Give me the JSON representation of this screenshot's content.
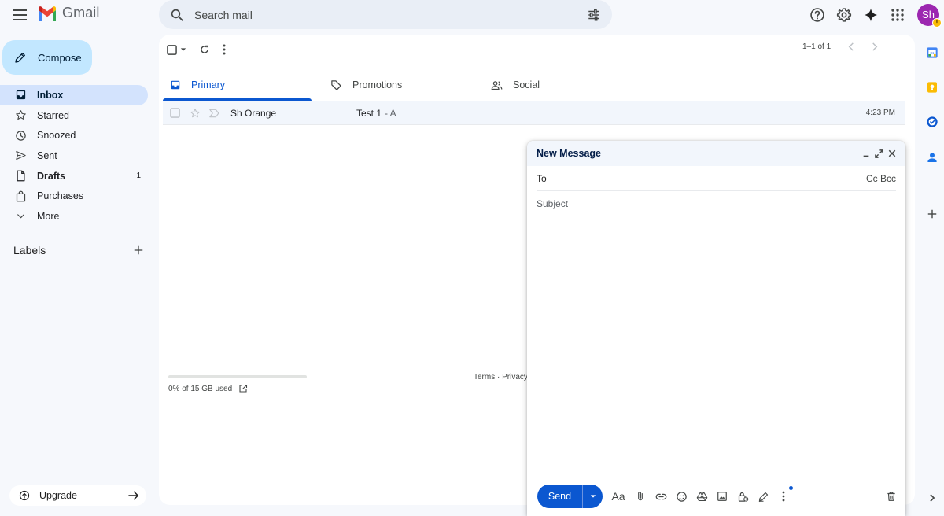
{
  "app": {
    "name": "Gmail"
  },
  "search": {
    "placeholder": "Search mail"
  },
  "user": {
    "avatar_initials": "Sh",
    "badge": "!"
  },
  "sidebar": {
    "compose_label": "Compose",
    "items": [
      {
        "label": "Inbox",
        "icon": "inbox-icon",
        "active": true
      },
      {
        "label": "Starred",
        "icon": "star-icon"
      },
      {
        "label": "Snoozed",
        "icon": "clock-icon"
      },
      {
        "label": "Sent",
        "icon": "send-icon"
      },
      {
        "label": "Drafts",
        "icon": "draft-icon",
        "count": "1",
        "bold": true
      },
      {
        "label": "Purchases",
        "icon": "shopping-bag-icon"
      },
      {
        "label": "More",
        "icon": "chevron-down-icon"
      }
    ],
    "labels_heading": "Labels",
    "upgrade_label": "Upgrade"
  },
  "list": {
    "pagination": "1–1 of 1",
    "tabs": [
      {
        "label": "Primary",
        "icon": "inbox-icon",
        "active": true
      },
      {
        "label": "Promotions",
        "icon": "tag-icon"
      },
      {
        "label": "Social",
        "icon": "people-icon"
      }
    ],
    "emails": [
      {
        "sender": "Sh Orange",
        "subject": "Test 1",
        "snippet": "- A",
        "time": "4:23 PM"
      }
    ]
  },
  "storage": {
    "text": "0% of 15 GB used",
    "fraction": 0
  },
  "footer": {
    "links": "Terms · Privacy"
  },
  "compose_window": {
    "title": "New Message",
    "to_label": "To",
    "cc_bcc": "Cc Bcc",
    "subject_placeholder": "Subject",
    "send_label": "Send",
    "format_label": "Aa"
  },
  "colors": {
    "accent": "#0b57d0",
    "compose_bg": "#c2e7ff",
    "active_nav": "#d3e3fd",
    "avatar": "#9c27b0"
  }
}
